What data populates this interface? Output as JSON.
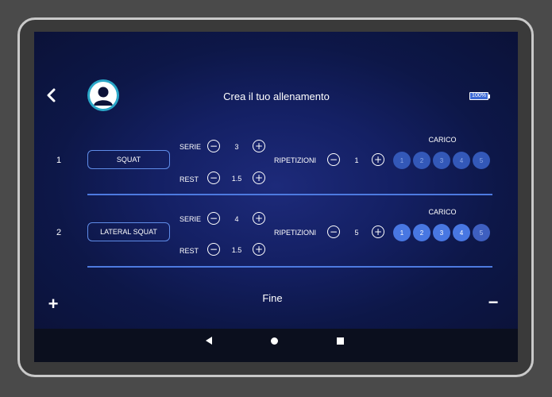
{
  "header": {
    "title": "Crea il tuo allenamento",
    "battery": "100%"
  },
  "rows": [
    {
      "number": "1",
      "exercise": "SQUAT",
      "serie_label": "SERIE",
      "serie_value": "3",
      "rest_label": "REST",
      "rest_value": "1.5",
      "ripetizioni_label": "RIPETIZIONI",
      "ripetizioni_value": "1",
      "carico_label": "CARICO",
      "carico_levels": [
        "1",
        "2",
        "3",
        "4",
        "5"
      ],
      "carico_selected": 0
    },
    {
      "number": "2",
      "exercise": "LATERAL SQUAT",
      "serie_label": "SERIE",
      "serie_value": "4",
      "rest_label": "REST",
      "rest_value": "1.5",
      "ripetizioni_label": "RIPETIZIONI",
      "ripetizioni_value": "5",
      "carico_label": "CARICO",
      "carico_levels": [
        "1",
        "2",
        "3",
        "4",
        "5"
      ],
      "carico_selected": 4
    }
  ],
  "footer": {
    "add_label": "+",
    "done_label": "Fine",
    "remove_label": "−"
  },
  "controls": {
    "minus": "−",
    "plus": "+"
  },
  "colors": {
    "accent": "#4d7ae0",
    "background": "#142064",
    "avatar_ring": "#2aa7c8"
  },
  "icons": {
    "back": "chevron-left-icon",
    "avatar": "user-avatar-icon",
    "battery": "battery-icon",
    "nav_back": "triangle-back-icon",
    "nav_home": "circle-home-icon",
    "nav_recent": "square-recent-icon"
  }
}
